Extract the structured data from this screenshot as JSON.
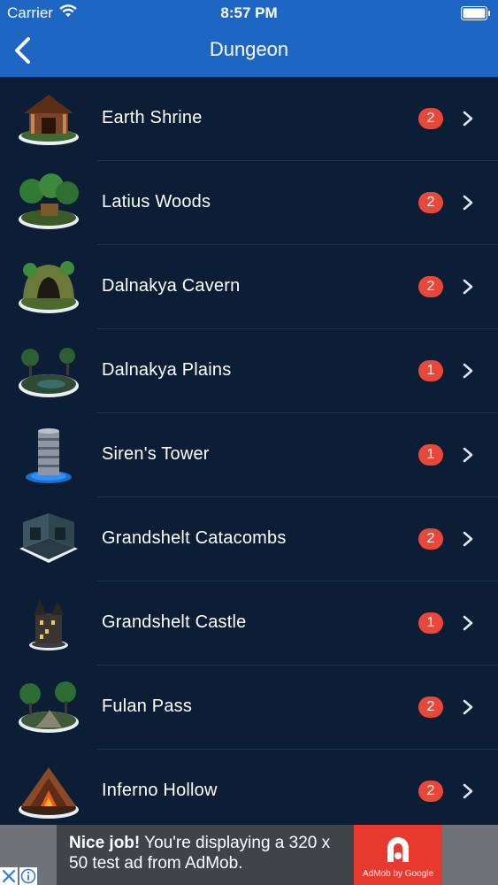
{
  "status_bar": {
    "carrier": "Carrier",
    "time": "8:57 PM",
    "wifi_icon": "wifi-icon",
    "battery_icon": "battery-icon"
  },
  "nav": {
    "title": "Dungeon",
    "back_icon": "chevron-left-icon"
  },
  "colors": {
    "header": "#1d66c4",
    "background": "#0b1e36",
    "badge": "#e8483a",
    "separator": "#1b3450"
  },
  "dungeons": [
    {
      "name": "Earth Shrine",
      "count": "2",
      "icon": "shrine-icon"
    },
    {
      "name": "Latius Woods",
      "count": "2",
      "icon": "woods-icon"
    },
    {
      "name": "Dalnakya Cavern",
      "count": "2",
      "icon": "cavern-icon"
    },
    {
      "name": "Dalnakya Plains",
      "count": "1",
      "icon": "plains-icon"
    },
    {
      "name": "Siren's Tower",
      "count": "1",
      "icon": "tower-icon"
    },
    {
      "name": "Grandshelt Catacombs",
      "count": "2",
      "icon": "catacombs-icon"
    },
    {
      "name": "Grandshelt Castle",
      "count": "1",
      "icon": "castle-icon"
    },
    {
      "name": "Fulan Pass",
      "count": "2",
      "icon": "pass-icon"
    },
    {
      "name": "Inferno Hollow",
      "count": "2",
      "icon": "volcano-icon"
    }
  ],
  "ad": {
    "headline": "Nice job!",
    "body": "You're displaying a 320 x 50 test ad from AdMob.",
    "brand": "AdMob by Google",
    "close_icon": "close-icon",
    "info_icon": "info-icon"
  }
}
